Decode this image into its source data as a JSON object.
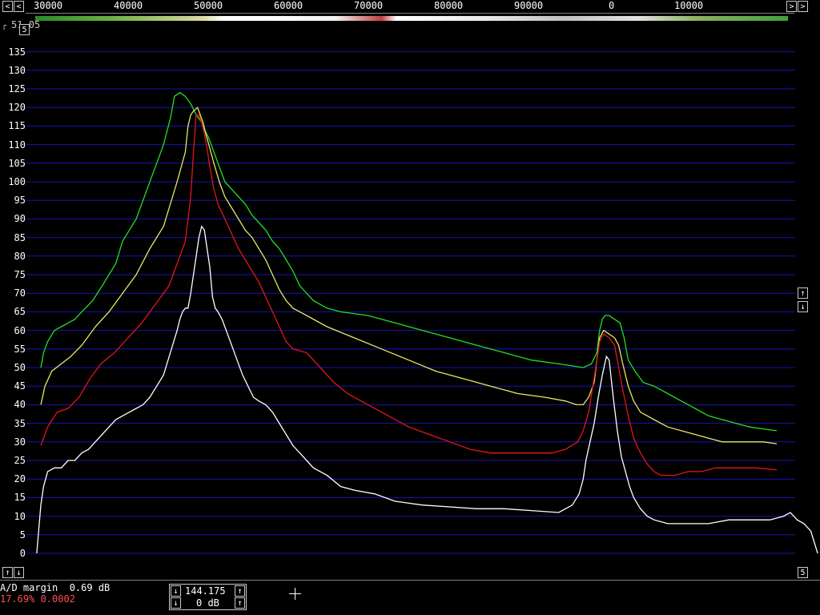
{
  "frequency_scale": {
    "labels": [
      "30000",
      "40000",
      "50000",
      "60000",
      "70000",
      "80000",
      "90000",
      "0",
      "10000"
    ]
  },
  "topleft_readout": "51.05",
  "topleft_button": "5",
  "y_axis": {
    "labels": [
      "135",
      "130",
      "125",
      "120",
      "115",
      "110",
      "105",
      "100",
      "95",
      "90",
      "85",
      "80",
      "75",
      "70",
      "65",
      "60",
      "55",
      "50",
      "45",
      "40",
      "35",
      "30",
      "25",
      "20",
      "15",
      "10",
      "5",
      "0"
    ]
  },
  "buttons": {
    "left_arrow": "<",
    "right_arrow": ">",
    "up_arrow": "↑",
    "down_arrow": "↓",
    "bottom_right": "5"
  },
  "status": {
    "ad_margin": "A/D margin  0.69 dB",
    "cpu": "17.69% 0.0002",
    "freq_value": "144.175",
    "gain_value": "0 dB"
  },
  "colors": {
    "grid": "#1414b4",
    "green": "#22e022",
    "yellow": "#e8e860",
    "red": "#e01818",
    "white": "#ffffff",
    "status_red": "#ff5050"
  },
  "chart_data": {
    "type": "line",
    "ylim": [
      0,
      135
    ],
    "series": [
      {
        "color": "green",
        "points": [
          [
            0,
            50
          ],
          [
            2,
            54
          ],
          [
            5,
            57
          ],
          [
            10,
            60
          ],
          [
            15,
            61
          ],
          [
            20,
            62
          ],
          [
            25,
            63
          ],
          [
            30,
            65
          ],
          [
            38,
            68
          ],
          [
            45,
            72
          ],
          [
            50,
            75
          ],
          [
            55,
            78
          ],
          [
            60,
            84
          ],
          [
            65,
            87
          ],
          [
            70,
            90
          ],
          [
            75,
            95
          ],
          [
            80,
            100
          ],
          [
            85,
            105
          ],
          [
            90,
            110
          ],
          [
            95,
            117
          ],
          [
            98,
            123
          ],
          [
            102,
            124
          ],
          [
            106,
            123
          ],
          [
            110,
            121
          ],
          [
            114,
            118
          ],
          [
            116,
            117
          ],
          [
            118,
            116
          ],
          [
            120,
            114
          ],
          [
            123,
            112
          ],
          [
            127,
            108
          ],
          [
            131,
            104
          ],
          [
            135,
            100
          ],
          [
            140,
            98
          ],
          [
            145,
            96
          ],
          [
            150,
            94
          ],
          [
            155,
            91
          ],
          [
            160,
            89
          ],
          [
            165,
            87
          ],
          [
            170,
            84
          ],
          [
            175,
            82
          ],
          [
            180,
            79
          ],
          [
            185,
            76
          ],
          [
            190,
            72
          ],
          [
            195,
            70
          ],
          [
            200,
            68
          ],
          [
            210,
            66
          ],
          [
            220,
            65
          ],
          [
            240,
            64
          ],
          [
            260,
            62
          ],
          [
            280,
            60
          ],
          [
            300,
            58
          ],
          [
            320,
            56
          ],
          [
            340,
            54
          ],
          [
            360,
            52
          ],
          [
            380,
            51
          ],
          [
            398,
            50
          ],
          [
            404,
            51
          ],
          [
            408,
            54
          ],
          [
            410,
            60
          ],
          [
            412,
            63
          ],
          [
            414,
            64
          ],
          [
            417,
            64
          ],
          [
            421,
            63
          ],
          [
            425,
            62
          ],
          [
            428,
            58
          ],
          [
            431,
            52
          ],
          [
            436,
            49
          ],
          [
            442,
            46
          ],
          [
            450,
            45
          ],
          [
            460,
            43
          ],
          [
            470,
            41
          ],
          [
            480,
            39
          ],
          [
            490,
            37
          ],
          [
            500,
            36
          ],
          [
            510,
            35
          ],
          [
            520,
            34
          ],
          [
            530,
            33.5
          ],
          [
            540,
            33
          ]
        ]
      },
      {
        "color": "yellow",
        "points": [
          [
            0,
            40
          ],
          [
            3,
            45
          ],
          [
            8,
            49
          ],
          [
            15,
            51
          ],
          [
            22,
            53
          ],
          [
            30,
            56
          ],
          [
            40,
            61
          ],
          [
            50,
            65
          ],
          [
            60,
            70
          ],
          [
            70,
            75
          ],
          [
            80,
            82
          ],
          [
            90,
            88
          ],
          [
            95,
            94
          ],
          [
            100,
            100
          ],
          [
            106,
            108
          ],
          [
            108,
            115
          ],
          [
            110,
            118
          ],
          [
            112,
            119
          ],
          [
            115,
            120
          ],
          [
            117,
            118
          ],
          [
            119,
            116
          ],
          [
            121,
            113
          ],
          [
            124,
            109
          ],
          [
            127,
            105
          ],
          [
            131,
            100
          ],
          [
            135,
            96
          ],
          [
            140,
            93
          ],
          [
            145,
            90
          ],
          [
            150,
            87
          ],
          [
            155,
            85
          ],
          [
            160,
            82
          ],
          [
            165,
            79
          ],
          [
            170,
            75
          ],
          [
            175,
            71
          ],
          [
            180,
            68
          ],
          [
            185,
            66
          ],
          [
            195,
            64
          ],
          [
            210,
            61
          ],
          [
            230,
            58
          ],
          [
            250,
            55
          ],
          [
            270,
            52
          ],
          [
            290,
            49
          ],
          [
            310,
            47
          ],
          [
            330,
            45
          ],
          [
            350,
            43
          ],
          [
            370,
            42
          ],
          [
            385,
            41
          ],
          [
            393,
            40
          ],
          [
            398,
            40
          ],
          [
            402,
            42
          ],
          [
            406,
            46
          ],
          [
            408,
            52
          ],
          [
            410,
            58
          ],
          [
            413,
            60
          ],
          [
            417,
            59
          ],
          [
            421,
            58
          ],
          [
            424,
            56
          ],
          [
            427,
            51
          ],
          [
            431,
            45
          ],
          [
            435,
            41
          ],
          [
            440,
            38
          ],
          [
            450,
            36
          ],
          [
            460,
            34
          ],
          [
            470,
            33
          ],
          [
            480,
            32
          ],
          [
            490,
            31
          ],
          [
            500,
            30
          ],
          [
            510,
            30
          ],
          [
            520,
            30
          ],
          [
            530,
            30
          ],
          [
            540,
            29.5
          ]
        ]
      },
      {
        "color": "red",
        "points": [
          [
            0,
            29
          ],
          [
            5,
            34
          ],
          [
            12,
            38
          ],
          [
            20,
            39
          ],
          [
            28,
            42
          ],
          [
            36,
            47
          ],
          [
            44,
            51
          ],
          [
            54,
            54
          ],
          [
            64,
            58
          ],
          [
            74,
            62
          ],
          [
            84,
            67
          ],
          [
            94,
            72
          ],
          [
            100,
            78
          ],
          [
            106,
            84
          ],
          [
            108,
            90
          ],
          [
            110,
            96
          ],
          [
            112,
            108
          ],
          [
            114,
            118
          ],
          [
            116,
            118
          ],
          [
            118,
            116
          ],
          [
            120,
            113
          ],
          [
            122,
            109
          ],
          [
            124,
            104
          ],
          [
            127,
            98
          ],
          [
            130,
            94
          ],
          [
            135,
            90
          ],
          [
            140,
            86
          ],
          [
            145,
            82
          ],
          [
            150,
            79
          ],
          [
            155,
            76
          ],
          [
            160,
            73
          ],
          [
            165,
            69
          ],
          [
            170,
            65
          ],
          [
            175,
            61
          ],
          [
            180,
            57
          ],
          [
            185,
            55
          ],
          [
            195,
            54
          ],
          [
            205,
            50
          ],
          [
            215,
            46
          ],
          [
            225,
            43
          ],
          [
            240,
            40
          ],
          [
            255,
            37
          ],
          [
            270,
            34
          ],
          [
            285,
            32
          ],
          [
            300,
            30
          ],
          [
            315,
            28
          ],
          [
            330,
            27
          ],
          [
            345,
            27
          ],
          [
            360,
            27
          ],
          [
            375,
            27
          ],
          [
            385,
            28
          ],
          [
            394,
            30
          ],
          [
            398,
            33
          ],
          [
            402,
            38
          ],
          [
            405,
            45
          ],
          [
            408,
            52
          ],
          [
            410,
            57
          ],
          [
            413,
            59
          ],
          [
            417,
            58
          ],
          [
            421,
            56
          ],
          [
            424,
            50
          ],
          [
            427,
            44
          ],
          [
            431,
            37
          ],
          [
            435,
            31
          ],
          [
            440,
            27
          ],
          [
            445,
            24
          ],
          [
            450,
            22
          ],
          [
            455,
            21
          ],
          [
            465,
            21
          ],
          [
            475,
            22
          ],
          [
            485,
            22
          ],
          [
            495,
            23
          ],
          [
            505,
            23
          ],
          [
            515,
            23
          ],
          [
            525,
            23
          ],
          [
            540,
            22.5
          ]
        ]
      },
      {
        "color": "white",
        "points": [
          [
            -3,
            0
          ],
          [
            0,
            13
          ],
          [
            2,
            18
          ],
          [
            5,
            22
          ],
          [
            10,
            23
          ],
          [
            15,
            23
          ],
          [
            20,
            25
          ],
          [
            25,
            25
          ],
          [
            30,
            27
          ],
          [
            35,
            28
          ],
          [
            40,
            30
          ],
          [
            45,
            32
          ],
          [
            50,
            34
          ],
          [
            55,
            36
          ],
          [
            60,
            37
          ],
          [
            65,
            38
          ],
          [
            70,
            39
          ],
          [
            75,
            40
          ],
          [
            80,
            42
          ],
          [
            85,
            45
          ],
          [
            90,
            48
          ],
          [
            95,
            54
          ],
          [
            100,
            60
          ],
          [
            102,
            63
          ],
          [
            104,
            65
          ],
          [
            106,
            66
          ],
          [
            108,
            66
          ],
          [
            110,
            70
          ],
          [
            112,
            75
          ],
          [
            114,
            80
          ],
          [
            116,
            85
          ],
          [
            118,
            88
          ],
          [
            120,
            87
          ],
          [
            122,
            82
          ],
          [
            124,
            77
          ],
          [
            126,
            69
          ],
          [
            128,
            66
          ],
          [
            130,
            65
          ],
          [
            133,
            63
          ],
          [
            136,
            60
          ],
          [
            140,
            56
          ],
          [
            144,
            52
          ],
          [
            148,
            48
          ],
          [
            152,
            45
          ],
          [
            156,
            42
          ],
          [
            160,
            41
          ],
          [
            165,
            40
          ],
          [
            170,
            38
          ],
          [
            175,
            35
          ],
          [
            180,
            32
          ],
          [
            185,
            29
          ],
          [
            190,
            27
          ],
          [
            195,
            25
          ],
          [
            200,
            23
          ],
          [
            210,
            21
          ],
          [
            220,
            18
          ],
          [
            230,
            17
          ],
          [
            245,
            16
          ],
          [
            260,
            14
          ],
          [
            280,
            13
          ],
          [
            300,
            12.5
          ],
          [
            320,
            12
          ],
          [
            340,
            12
          ],
          [
            360,
            11.5
          ],
          [
            380,
            11
          ],
          [
            390,
            13
          ],
          [
            395,
            16
          ],
          [
            398,
            20
          ],
          [
            400,
            25
          ],
          [
            403,
            30
          ],
          [
            406,
            35
          ],
          [
            409,
            42
          ],
          [
            412,
            48
          ],
          [
            415,
            53
          ],
          [
            417,
            52
          ],
          [
            420,
            42
          ],
          [
            423,
            33
          ],
          [
            426,
            26
          ],
          [
            429,
            22
          ],
          [
            432,
            18
          ],
          [
            435,
            15
          ],
          [
            440,
            12
          ],
          [
            445,
            10
          ],
          [
            450,
            9
          ],
          [
            460,
            8
          ],
          [
            475,
            8
          ],
          [
            490,
            8
          ],
          [
            505,
            9
          ],
          [
            520,
            9
          ],
          [
            535,
            9
          ],
          [
            545,
            10
          ],
          [
            550,
            11
          ],
          [
            555,
            9
          ],
          [
            560,
            8
          ],
          [
            565,
            6
          ],
          [
            570,
            0
          ]
        ]
      }
    ]
  }
}
